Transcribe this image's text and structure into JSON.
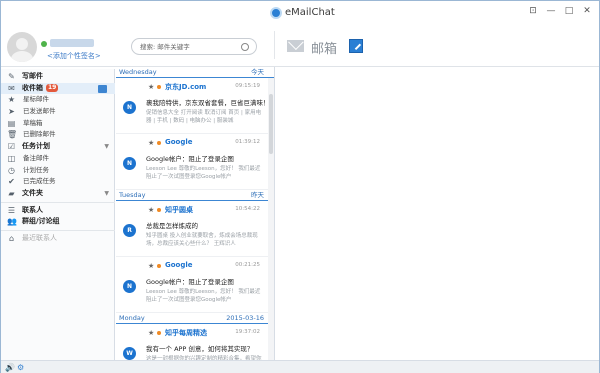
{
  "app": {
    "title": "eMailChat"
  },
  "window_controls": [
    "⊡",
    "—",
    "□",
    "✕"
  ],
  "profile": {
    "signature": "<添加个性签名>"
  },
  "search": {
    "placeholder": "搜索: 邮件关键字"
  },
  "sidebar": {
    "items": [
      {
        "label": "写邮件",
        "icon": "compose-icon",
        "glyph": "✎",
        "type": "main"
      },
      {
        "label": "收件箱",
        "icon": "inbox-icon",
        "glyph": "✉",
        "type": "main",
        "badge": "19",
        "selected": true
      },
      {
        "label": "星标邮件",
        "icon": "star-icon",
        "glyph": "★",
        "type": "sub"
      },
      {
        "label": "已发送邮件",
        "icon": "sent-icon",
        "glyph": "➤",
        "type": "sub"
      },
      {
        "label": "草稿箱",
        "icon": "drafts-icon",
        "glyph": "▤",
        "type": "sub"
      },
      {
        "label": "已删除邮件",
        "icon": "trash-icon",
        "glyph": "🗑",
        "type": "sub"
      },
      {
        "label": "任务计划",
        "icon": "tasks-icon",
        "glyph": "☑",
        "type": "main"
      },
      {
        "label": "备注邮件",
        "icon": "note-icon",
        "glyph": "◫",
        "type": "sub"
      },
      {
        "label": "计划任务",
        "icon": "clock-icon",
        "glyph": "◷",
        "type": "sub"
      },
      {
        "label": "已完成任务",
        "icon": "check-icon",
        "glyph": "✔",
        "type": "sub"
      },
      {
        "label": "文件夹",
        "icon": "folder-icon",
        "glyph": "▰",
        "type": "main"
      },
      {
        "label": "联系人",
        "icon": "contacts-icon",
        "glyph": "☰",
        "type": "main"
      },
      {
        "label": "群组/讨论组",
        "icon": "group-icon",
        "glyph": "👥",
        "type": "main"
      },
      {
        "label": "最近联系人",
        "icon": "recent-icon",
        "glyph": "⌂",
        "type": "muted"
      }
    ]
  },
  "mail_groups": [
    {
      "day": "Wednesday",
      "relative": "今天",
      "mails": [
        {
          "sender": "京东JD.com",
          "time": "09:15:19",
          "avatar": "N",
          "subject": "裹我陪特供，京东双省套餐，巨省巨满味！",
          "preview": "促销信息大全 打开阅读 取消订阅 首页 | 家用电器 | 手机 | 数码 | 电脑办公 | 服装城"
        },
        {
          "sender": "Google",
          "time": "01:39:12",
          "avatar": "N",
          "subject": "Google帐户：阻止了登录企图",
          "preview": "Leeson Lee 尊敬的Leeson，您好！ 我们最近阻止了一次试图登录您Google帐户"
        }
      ]
    },
    {
      "day": "Tuesday",
      "relative": "昨天",
      "mails": [
        {
          "sender": "知乎圆桌",
          "time": "10:54:22",
          "avatar": "R",
          "subject": "总裁是怎样炼成的",
          "preview": "知乎圆桌 投入创业就要取舍，炼成会场总裁现场，总裁应该关心些什么？ 王辉识人"
        },
        {
          "sender": "Google",
          "time": "00:21:25",
          "avatar": "N",
          "subject": "Google帐户：阻止了登录企图",
          "preview": "Leeson Lee 尊敬的Leeson，您好！ 我们最近阻止了一次试图登录您Google帐户"
        }
      ]
    },
    {
      "day": "Monday",
      "relative": "2015-03-16",
      "mails": [
        {
          "sender": "知乎每周精选",
          "time": "19:37:02",
          "avatar": "W",
          "subject": "我有一个 APP 创意，如何将其实现？",
          "preview": "这是一封根据你的兴趣定制的精彩合集，希望你每期都能有所收获。 如果"
        }
      ]
    }
  ],
  "right_header": {
    "label": "邮箱"
  },
  "colors": {
    "accent": "#1c73cf",
    "badge": "#e35a3d",
    "unread_dot": "#f08a24",
    "online": "#4fb34a"
  }
}
